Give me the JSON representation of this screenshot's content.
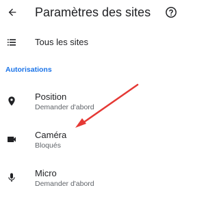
{
  "header": {
    "back_icon": "arrow-back-icon",
    "title": "Paramètres des sites",
    "help_icon": "help-circle-icon"
  },
  "all_sites": {
    "icon": "list-icon",
    "label": "Tous les sites"
  },
  "permissions": {
    "section_title": "Autorisations",
    "items": [
      {
        "icon": "location-pin-icon",
        "label": "Position",
        "status": "Demander d'abord"
      },
      {
        "icon": "video-camera-icon",
        "label": "Caméra",
        "status": "Bloqués"
      },
      {
        "icon": "microphone-icon",
        "label": "Micro",
        "status": "Demander d'abord"
      }
    ]
  },
  "annotation": {
    "arrow_color": "#e53935"
  },
  "colors": {
    "accent": "#1a73e8",
    "text_primary": "#202124",
    "text_secondary": "#5f6368"
  }
}
